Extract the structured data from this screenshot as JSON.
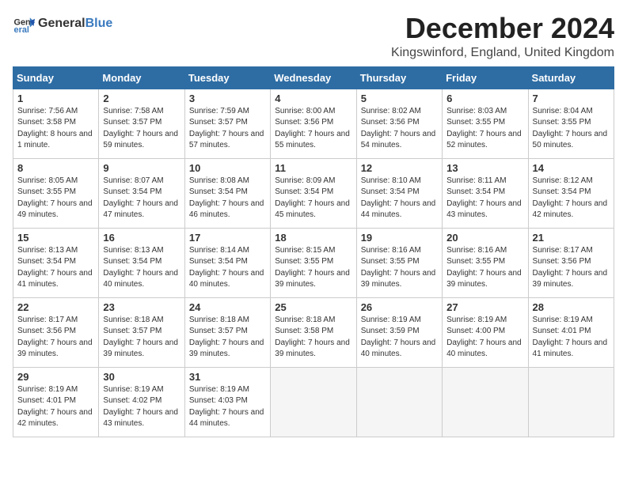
{
  "header": {
    "logo_general": "General",
    "logo_blue": "Blue",
    "title": "December 2024",
    "subtitle": "Kingswinford, England, United Kingdom"
  },
  "weekdays": [
    "Sunday",
    "Monday",
    "Tuesday",
    "Wednesday",
    "Thursday",
    "Friday",
    "Saturday"
  ],
  "weeks": [
    [
      {
        "day": "1",
        "sunrise": "7:56 AM",
        "sunset": "3:58 PM",
        "daylight": "8 hours and 1 minute."
      },
      {
        "day": "2",
        "sunrise": "7:58 AM",
        "sunset": "3:57 PM",
        "daylight": "7 hours and 59 minutes."
      },
      {
        "day": "3",
        "sunrise": "7:59 AM",
        "sunset": "3:57 PM",
        "daylight": "7 hours and 57 minutes."
      },
      {
        "day": "4",
        "sunrise": "8:00 AM",
        "sunset": "3:56 PM",
        "daylight": "7 hours and 55 minutes."
      },
      {
        "day": "5",
        "sunrise": "8:02 AM",
        "sunset": "3:56 PM",
        "daylight": "7 hours and 54 minutes."
      },
      {
        "day": "6",
        "sunrise": "8:03 AM",
        "sunset": "3:55 PM",
        "daylight": "7 hours and 52 minutes."
      },
      {
        "day": "7",
        "sunrise": "8:04 AM",
        "sunset": "3:55 PM",
        "daylight": "7 hours and 50 minutes."
      }
    ],
    [
      {
        "day": "8",
        "sunrise": "8:05 AM",
        "sunset": "3:55 PM",
        "daylight": "7 hours and 49 minutes."
      },
      {
        "day": "9",
        "sunrise": "8:07 AM",
        "sunset": "3:54 PM",
        "daylight": "7 hours and 47 minutes."
      },
      {
        "day": "10",
        "sunrise": "8:08 AM",
        "sunset": "3:54 PM",
        "daylight": "7 hours and 46 minutes."
      },
      {
        "day": "11",
        "sunrise": "8:09 AM",
        "sunset": "3:54 PM",
        "daylight": "7 hours and 45 minutes."
      },
      {
        "day": "12",
        "sunrise": "8:10 AM",
        "sunset": "3:54 PM",
        "daylight": "7 hours and 44 minutes."
      },
      {
        "day": "13",
        "sunrise": "8:11 AM",
        "sunset": "3:54 PM",
        "daylight": "7 hours and 43 minutes."
      },
      {
        "day": "14",
        "sunrise": "8:12 AM",
        "sunset": "3:54 PM",
        "daylight": "7 hours and 42 minutes."
      }
    ],
    [
      {
        "day": "15",
        "sunrise": "8:13 AM",
        "sunset": "3:54 PM",
        "daylight": "7 hours and 41 minutes."
      },
      {
        "day": "16",
        "sunrise": "8:13 AM",
        "sunset": "3:54 PM",
        "daylight": "7 hours and 40 minutes."
      },
      {
        "day": "17",
        "sunrise": "8:14 AM",
        "sunset": "3:54 PM",
        "daylight": "7 hours and 40 minutes."
      },
      {
        "day": "18",
        "sunrise": "8:15 AM",
        "sunset": "3:55 PM",
        "daylight": "7 hours and 39 minutes."
      },
      {
        "day": "19",
        "sunrise": "8:16 AM",
        "sunset": "3:55 PM",
        "daylight": "7 hours and 39 minutes."
      },
      {
        "day": "20",
        "sunrise": "8:16 AM",
        "sunset": "3:55 PM",
        "daylight": "7 hours and 39 minutes."
      },
      {
        "day": "21",
        "sunrise": "8:17 AM",
        "sunset": "3:56 PM",
        "daylight": "7 hours and 39 minutes."
      }
    ],
    [
      {
        "day": "22",
        "sunrise": "8:17 AM",
        "sunset": "3:56 PM",
        "daylight": "7 hours and 39 minutes."
      },
      {
        "day": "23",
        "sunrise": "8:18 AM",
        "sunset": "3:57 PM",
        "daylight": "7 hours and 39 minutes."
      },
      {
        "day": "24",
        "sunrise": "8:18 AM",
        "sunset": "3:57 PM",
        "daylight": "7 hours and 39 minutes."
      },
      {
        "day": "25",
        "sunrise": "8:18 AM",
        "sunset": "3:58 PM",
        "daylight": "7 hours and 39 minutes."
      },
      {
        "day": "26",
        "sunrise": "8:19 AM",
        "sunset": "3:59 PM",
        "daylight": "7 hours and 40 minutes."
      },
      {
        "day": "27",
        "sunrise": "8:19 AM",
        "sunset": "4:00 PM",
        "daylight": "7 hours and 40 minutes."
      },
      {
        "day": "28",
        "sunrise": "8:19 AM",
        "sunset": "4:01 PM",
        "daylight": "7 hours and 41 minutes."
      }
    ],
    [
      {
        "day": "29",
        "sunrise": "8:19 AM",
        "sunset": "4:01 PM",
        "daylight": "7 hours and 42 minutes."
      },
      {
        "day": "30",
        "sunrise": "8:19 AM",
        "sunset": "4:02 PM",
        "daylight": "7 hours and 43 minutes."
      },
      {
        "day": "31",
        "sunrise": "8:19 AM",
        "sunset": "4:03 PM",
        "daylight": "7 hours and 44 minutes."
      },
      null,
      null,
      null,
      null
    ]
  ],
  "labels": {
    "sunrise": "Sunrise:",
    "sunset": "Sunset:",
    "daylight": "Daylight:"
  }
}
